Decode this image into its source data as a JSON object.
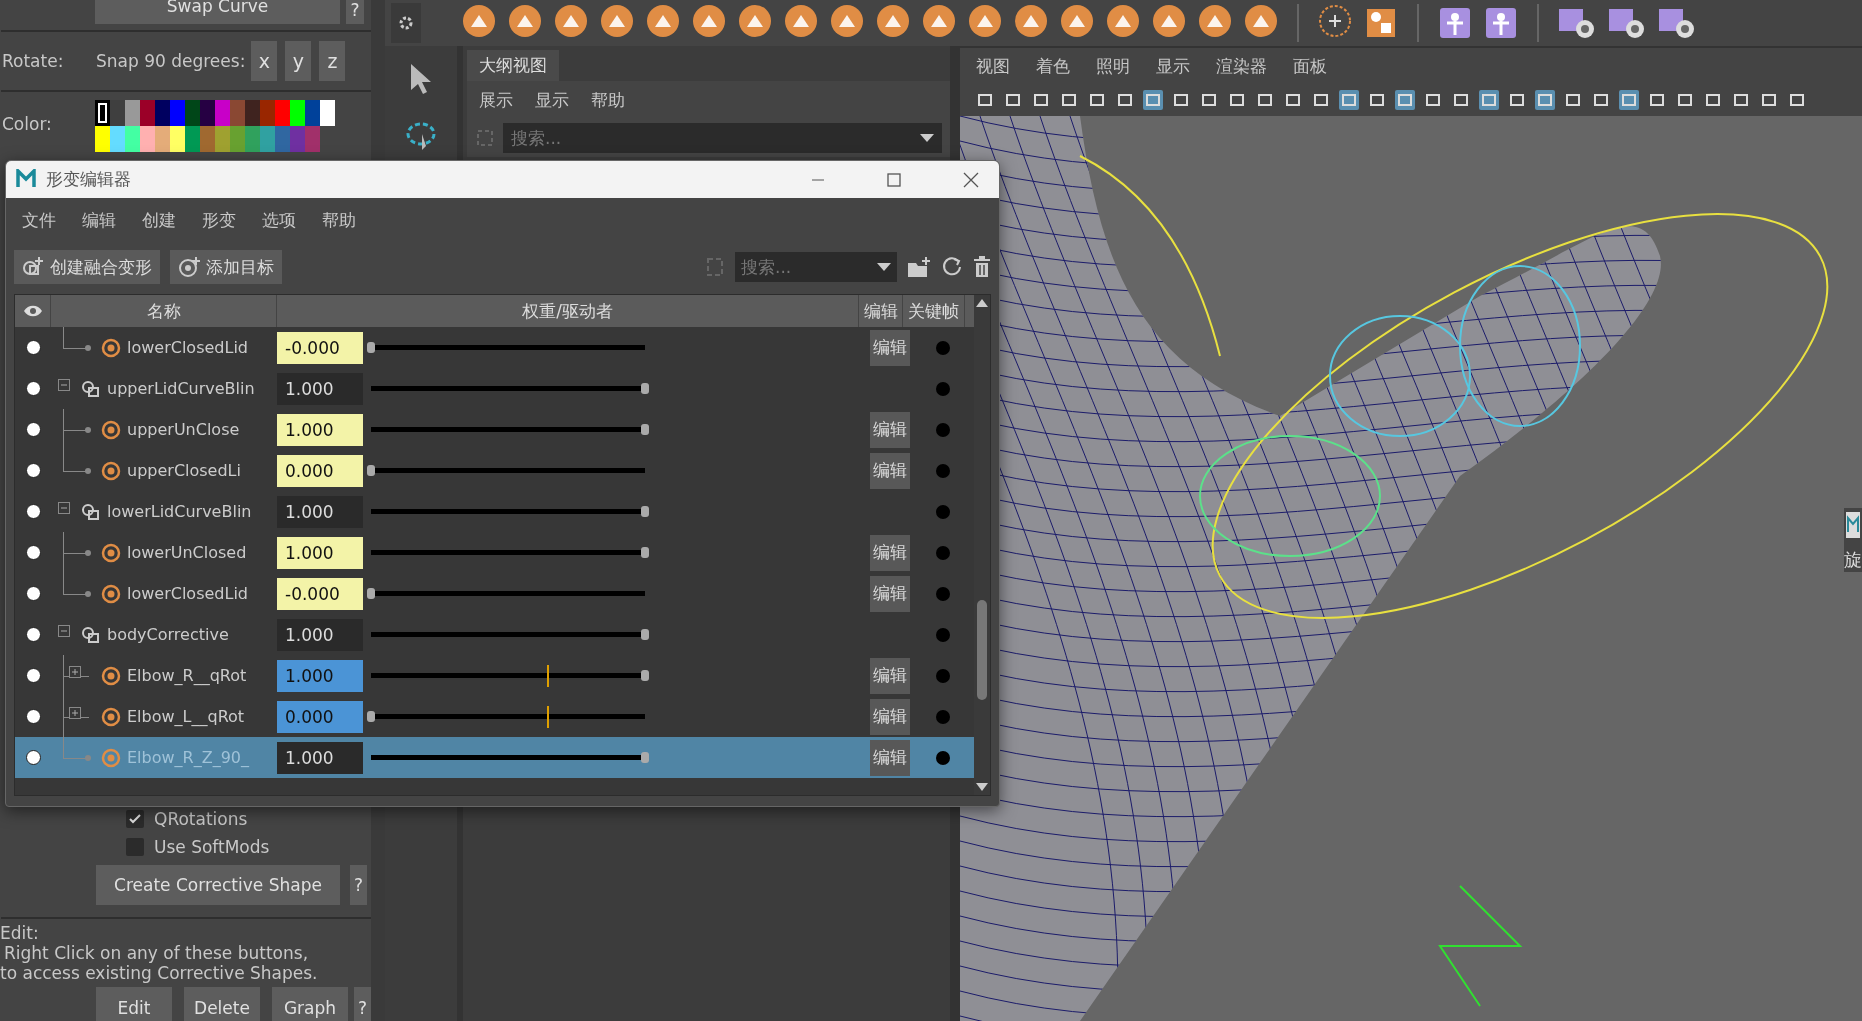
{
  "left_panel": {
    "swap_button": "Swap Curve",
    "swap_help": "?",
    "rotate_label": "Rotate:",
    "snap_label": "Snap 90 degrees:",
    "axis_buttons": [
      "x",
      "y",
      "z"
    ],
    "color_label": "Color:",
    "swatches": [
      {
        "color": "#000000",
        "selected": true
      },
      {
        "color": "#3f3f3f",
        "selected": false
      },
      {
        "color": "#999999",
        "selected": false
      },
      {
        "color": "#9b0028",
        "selected": false
      },
      {
        "color": "#000060",
        "selected": false
      },
      {
        "color": "#0000ff",
        "selected": false
      },
      {
        "color": "#004618",
        "selected": false
      },
      {
        "color": "#260043",
        "selected": false
      },
      {
        "color": "#c800c8",
        "selected": false
      },
      {
        "color": "#8a4833",
        "selected": false
      },
      {
        "color": "#3f231f",
        "selected": false
      },
      {
        "color": "#992600",
        "selected": false
      },
      {
        "color": "#ff0000",
        "selected": false
      },
      {
        "color": "#00ff00",
        "selected": false
      },
      {
        "color": "#00419a",
        "selected": false
      },
      {
        "color": "#ffffff",
        "selected": false
      },
      {
        "color": "#ffff00",
        "selected": false
      },
      {
        "color": "#64dcff",
        "selected": false
      },
      {
        "color": "#43ffa3",
        "selected": false
      },
      {
        "color": "#ffb0b0",
        "selected": false
      },
      {
        "color": "#e4ac79",
        "selected": false
      },
      {
        "color": "#ffff63",
        "selected": false
      },
      {
        "color": "#009954",
        "selected": false
      },
      {
        "color": "#a06930",
        "selected": false
      },
      {
        "color": "#9fa130",
        "selected": false
      },
      {
        "color": "#68a130",
        "selected": false
      },
      {
        "color": "#30a15d",
        "selected": false
      },
      {
        "color": "#30a1a1",
        "selected": false
      },
      {
        "color": "#3067a1",
        "selected": false
      },
      {
        "color": "#6f30a1",
        "selected": false
      },
      {
        "color": "#a1306a",
        "selected": false
      }
    ],
    "options": [
      {
        "label": "QRotations",
        "checked": true
      },
      {
        "label": "Use SoftMods",
        "checked": false
      }
    ],
    "create_button": "Create Corrective Shape",
    "create_help": "?",
    "edit_label": "Edit:",
    "edit_hint": [
      "Right Click on any of these buttons,",
      "to access existing Corrective Shapes."
    ],
    "edit_buttons": [
      "Edit",
      "Delete",
      "Graph"
    ],
    "edit_help": "?"
  },
  "outliner": {
    "tab": "大纲视图",
    "menu": [
      "展示",
      "显示",
      "帮助"
    ],
    "search_placeholder": "搜索..."
  },
  "viewport": {
    "menu": [
      "视图",
      "着色",
      "照明",
      "显示",
      "渲染器",
      "面板"
    ],
    "side_text": "旋"
  },
  "shape_editor": {
    "title": "形变编辑器",
    "menu": [
      "文件",
      "编辑",
      "创建",
      "形变",
      "选项",
      "帮助"
    ],
    "buttons": [
      "创建融合变形",
      "添加目标"
    ],
    "search_placeholder": "搜索...",
    "columns": [
      "名称",
      "权重/驱动者",
      "编辑",
      "关键帧"
    ],
    "rows": [
      {
        "kind": "target",
        "name": "lowerClosedLid",
        "weight": "-0.000",
        "keyed": true,
        "driven": false,
        "level": 0,
        "visible": true,
        "edit": "编辑",
        "selected": false
      },
      {
        "kind": "group",
        "name": "upperLidCurveBlin",
        "weight": "1.000",
        "keyed": false,
        "driven": false,
        "level": 1,
        "visible": true,
        "expanded": true,
        "selected": false,
        "children": [
          {
            "kind": "target",
            "name": "upperUnClose",
            "weight": "1.000",
            "keyed": true,
            "driven": false,
            "level": 1,
            "visible": true,
            "edit": "编辑",
            "selected": false
          },
          {
            "kind": "target",
            "name": "upperClosedLi",
            "weight": "0.000",
            "keyed": true,
            "driven": false,
            "level": 0,
            "visible": true,
            "edit": "编辑",
            "selected": false
          }
        ]
      },
      {
        "kind": "group",
        "name": "lowerLidCurveBlin",
        "weight": "1.000",
        "keyed": false,
        "driven": false,
        "level": 1,
        "visible": true,
        "expanded": true,
        "selected": false,
        "children": [
          {
            "kind": "target",
            "name": "lowerUnClosed",
            "weight": "1.000",
            "keyed": true,
            "driven": false,
            "level": 1,
            "visible": true,
            "edit": "编辑",
            "selected": false
          },
          {
            "kind": "target",
            "name": "lowerClosedLid",
            "weight": "-0.000",
            "keyed": true,
            "driven": false,
            "level": 0,
            "visible": true,
            "edit": "编辑",
            "selected": false
          }
        ]
      },
      {
        "kind": "group",
        "name": "bodyCorrective",
        "weight": "1.000",
        "keyed": false,
        "driven": false,
        "level": 1,
        "visible": true,
        "expanded": true,
        "selected": false,
        "children": [
          {
            "kind": "target",
            "name": "Elbow_R__qRot",
            "weight": "1.000",
            "keyed": false,
            "driven": true,
            "level": 1,
            "driver": true,
            "visible": true,
            "expanded": false,
            "edit": "编辑",
            "selected": false
          },
          {
            "kind": "target",
            "name": "Elbow_L__qRot",
            "weight": "0.000",
            "keyed": false,
            "driven": true,
            "level": 0,
            "driver": true,
            "visible": true,
            "expanded": false,
            "edit": "编辑",
            "selected": false
          },
          {
            "kind": "target",
            "name": "Elbow_R_Z_90_",
            "weight": "1.000",
            "keyed": false,
            "driven": false,
            "level": 1,
            "visible": true,
            "edit": "编辑",
            "selected": true
          }
        ]
      }
    ]
  }
}
